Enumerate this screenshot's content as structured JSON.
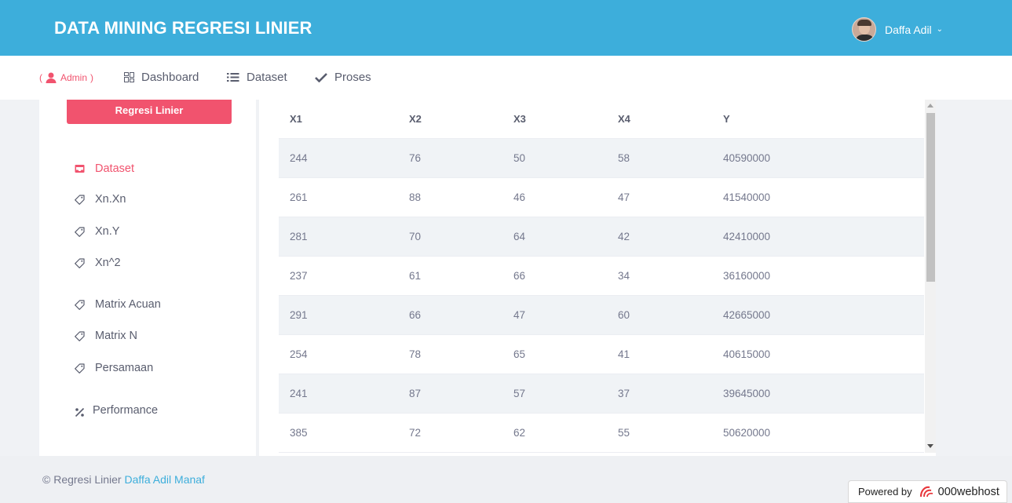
{
  "header": {
    "title": "DATA MINING REGRESI LINIER",
    "user_name": "Daffa Adil"
  },
  "nav": {
    "admin_open": "(",
    "admin_label": "Admin",
    "admin_close": ")",
    "items": [
      {
        "label": "Dashboard",
        "icon": "dashboard-icon"
      },
      {
        "label": "Dataset",
        "icon": "list-icon"
      },
      {
        "label": "Proses",
        "icon": "check-icon"
      }
    ]
  },
  "sidebar": {
    "button_label": "Regresi Linier",
    "items": [
      {
        "label": "Dataset",
        "icon": "inbox-icon",
        "active": true
      },
      {
        "label": "Xn.Xn",
        "icon": "tag-icon"
      },
      {
        "label": "Xn.Y",
        "icon": "tag-icon"
      },
      {
        "label": "Xn^2",
        "icon": "tag-icon"
      },
      {
        "label": "Matrix Acuan",
        "icon": "tag-icon"
      },
      {
        "label": "Matrix N",
        "icon": "tag-icon"
      },
      {
        "label": "Persamaan",
        "icon": "tag-icon"
      },
      {
        "label": "Performance",
        "icon": "percent-icon"
      }
    ]
  },
  "table": {
    "columns": [
      "X1",
      "X2",
      "X3",
      "X4",
      "Y"
    ],
    "rows": [
      [
        "244",
        "76",
        "50",
        "58",
        "40590000"
      ],
      [
        "261",
        "88",
        "46",
        "47",
        "41540000"
      ],
      [
        "281",
        "70",
        "64",
        "42",
        "42410000"
      ],
      [
        "237",
        "61",
        "66",
        "34",
        "36160000"
      ],
      [
        "291",
        "66",
        "47",
        "60",
        "42665000"
      ],
      [
        "254",
        "78",
        "65",
        "41",
        "40615000"
      ],
      [
        "241",
        "87",
        "57",
        "37",
        "39645000"
      ],
      [
        "385",
        "72",
        "62",
        "55",
        "50620000"
      ]
    ]
  },
  "footer": {
    "copyright": "© Regresi Linier",
    "author": "Daffa Adil Manaf",
    "powered_label": "Powered by",
    "powered_brand": "000webhost"
  },
  "colors": {
    "header_bg": "#3daedb",
    "accent": "#f1536e",
    "link": "#3daedb"
  }
}
